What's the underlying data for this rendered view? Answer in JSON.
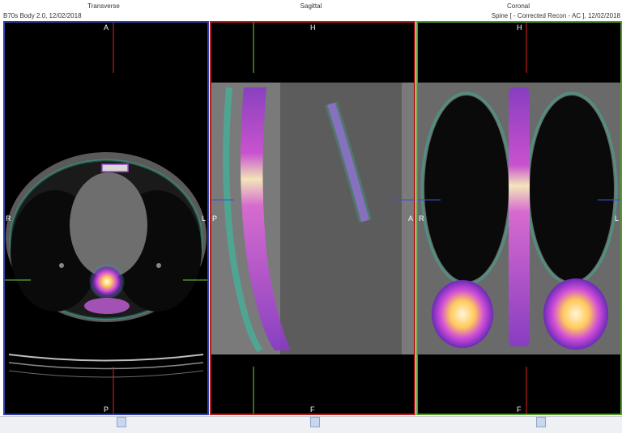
{
  "views": [
    {
      "title": "Transverse",
      "labels": {
        "top": "A",
        "bottom": "P",
        "left": "R",
        "right": "L"
      },
      "border_color": "#2f3fa6"
    },
    {
      "title": "Sagittal",
      "labels": {
        "top": "H",
        "bottom": "F",
        "left": "P",
        "right": "A"
      },
      "border_color": "#b01e1e"
    },
    {
      "title": "Coronal",
      "labels": {
        "top": "H",
        "bottom": "F",
        "left": "R",
        "right": "L"
      },
      "border_color": "#4f9a2a"
    }
  ],
  "header": {
    "left_info": "B70s Body 2.0, 12/02/2018",
    "right_info": "Spine [ - Corrected Recon - AC ], 12/02/2018"
  },
  "colors": {
    "crosshair_red": "#e02020",
    "crosshair_green": "#7ad13a",
    "crosshair_blue": "#3a4fd6"
  }
}
